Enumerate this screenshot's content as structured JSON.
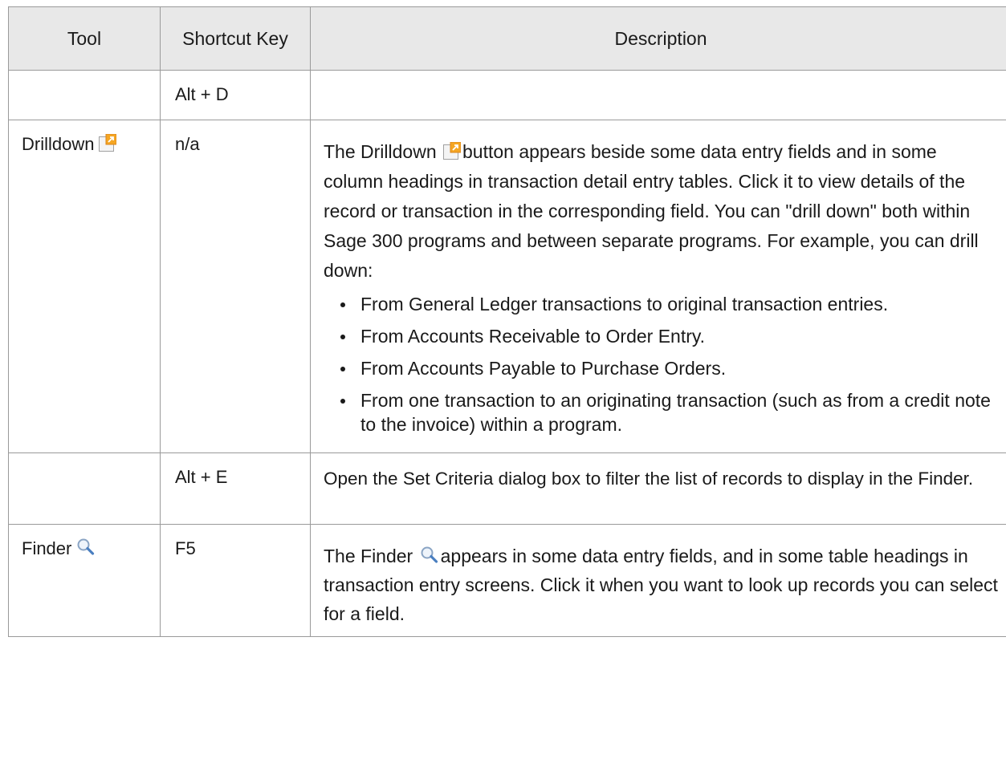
{
  "table": {
    "headers": {
      "tool": "Tool",
      "shortcut": "Shortcut Key",
      "description": "Description"
    },
    "rows": [
      {
        "tool": "",
        "shortcut": "Alt + D",
        "description": ""
      },
      {
        "tool": "Drilldown",
        "tool_icon": "drilldown-icon",
        "shortcut": "n/a",
        "description_part1": "The Drilldown",
        "description_part2": "button appears beside some data entry fields and in some column headings in transaction detail entry tables. Click it to view details of the record or transaction in the corresponding field. You can \"drill down\" both within Sage 300 programs and between separate programs. For example, you can drill down:",
        "bullets": [
          "From General Ledger transactions to original transaction entries.",
          "From Accounts Receivable to Order Entry.",
          "From Accounts Payable to Purchase Orders.",
          "From one transaction to an originating transaction (such as from a credit note to the invoice) within a program."
        ]
      },
      {
        "tool": "",
        "shortcut": "Alt + E",
        "description": "Open the Set Criteria dialog box to filter the list of records to display in the Finder."
      },
      {
        "tool": "Finder",
        "tool_icon": "finder-icon",
        "shortcut": "F5",
        "description_part1": "The Finder",
        "description_part2": "appears in some data entry fields, and in some table headings in transaction entry screens. Click it when you want to look up records you can select for a field."
      }
    ]
  },
  "colors": {
    "header_bg": "#e8e8e8",
    "border": "#9a9a9a",
    "drilldown_orange": "#f5a623",
    "finder_blue": "#4a7fc0"
  }
}
